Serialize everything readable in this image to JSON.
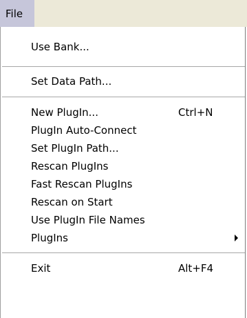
{
  "menubar": {
    "file_label": "File"
  },
  "menu": {
    "items": [
      {
        "label": "Use Bank..."
      },
      {
        "label": "Set Data Path..."
      },
      {
        "label": "New PlugIn...",
        "shortcut": "Ctrl+N"
      },
      {
        "label": "PlugIn Auto-Connect"
      },
      {
        "label": "Set PlugIn Path..."
      },
      {
        "label": "Rescan PlugIns"
      },
      {
        "label": "Fast Rescan PlugIns"
      },
      {
        "label": "Rescan on Start"
      },
      {
        "label": "Use PlugIn File Names"
      },
      {
        "label": "PlugIns",
        "has_submenu": true
      },
      {
        "label": "Exit",
        "shortcut": "Alt+F4"
      }
    ]
  }
}
